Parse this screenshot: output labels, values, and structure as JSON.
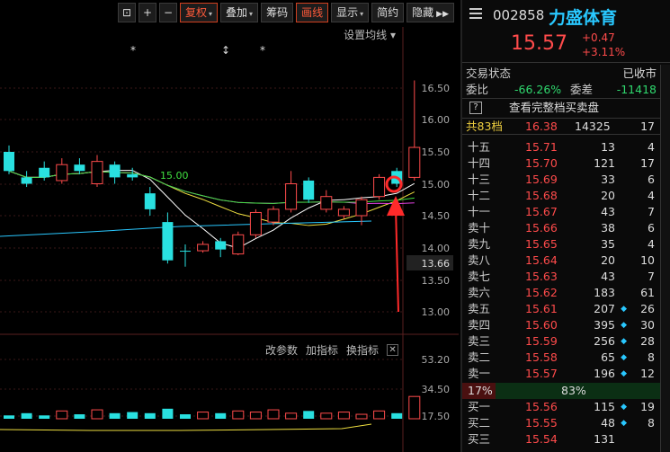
{
  "toolbar": {
    "items": [
      "复权",
      "叠加",
      "筹码",
      "画线",
      "显示",
      "简约",
      "隐藏"
    ],
    "expand_icon": "double-chevron-right-icon"
  },
  "chart": {
    "settings_label": "设置均线",
    "price_ticks": [
      "16.50",
      "16.00",
      "15.50",
      "15.00",
      "14.50",
      "14.00",
      "13.66",
      "13.50",
      "13.00"
    ],
    "ma_label": "15.00",
    "markers": [
      "*",
      "↕",
      "*"
    ],
    "vol_ticks": [
      "53.20",
      "34.50",
      "17.50"
    ],
    "bottom_tools": [
      "改参数",
      "加指标",
      "换指标"
    ],
    "candles": [
      {
        "o": 15.5,
        "c": 15.2,
        "h": 15.6,
        "l": 15.15
      },
      {
        "o": 15.1,
        "c": 15.0,
        "h": 15.2,
        "l": 14.95
      },
      {
        "o": 15.25,
        "c": 15.1,
        "h": 15.35,
        "l": 15.05
      },
      {
        "o": 15.05,
        "c": 15.3,
        "h": 15.4,
        "l": 15.0
      },
      {
        "o": 15.3,
        "c": 15.2,
        "h": 15.4,
        "l": 15.15
      },
      {
        "o": 15.0,
        "c": 15.35,
        "h": 15.45,
        "l": 14.95
      },
      {
        "o": 15.3,
        "c": 15.1,
        "h": 15.35,
        "l": 15.0
      },
      {
        "o": 15.15,
        "c": 15.1,
        "h": 15.25,
        "l": 15.05
      },
      {
        "o": 14.85,
        "c": 14.6,
        "h": 14.95,
        "l": 14.5
      },
      {
        "o": 14.4,
        "c": 13.8,
        "h": 14.55,
        "l": 13.75
      },
      {
        "o": 13.95,
        "c": 13.94,
        "h": 14.05,
        "l": 13.7
      },
      {
        "o": 13.95,
        "c": 14.05,
        "h": 14.1,
        "l": 13.92
      },
      {
        "o": 14.1,
        "c": 13.97,
        "h": 14.15,
        "l": 13.85
      },
      {
        "o": 13.9,
        "c": 14.2,
        "h": 14.25,
        "l": 13.88
      },
      {
        "o": 14.2,
        "c": 14.55,
        "h": 14.6,
        "l": 14.15
      },
      {
        "o": 14.4,
        "c": 14.6,
        "h": 14.65,
        "l": 14.35
      },
      {
        "o": 14.6,
        "c": 15.0,
        "h": 15.2,
        "l": 14.55
      },
      {
        "o": 15.05,
        "c": 14.75,
        "h": 15.1,
        "l": 14.7
      },
      {
        "o": 14.6,
        "c": 14.8,
        "h": 14.9,
        "l": 14.55
      },
      {
        "o": 14.5,
        "c": 14.6,
        "h": 14.65,
        "l": 14.45
      },
      {
        "o": 14.5,
        "c": 14.75,
        "h": 14.8,
        "l": 14.35
      },
      {
        "o": 14.8,
        "c": 15.1,
        "h": 15.15,
        "l": 14.75
      },
      {
        "o": 15.2,
        "c": 15.0,
        "h": 15.25,
        "l": 14.95
      },
      {
        "o": 15.1,
        "c": 15.57,
        "h": 16.62,
        "l": 15.05
      }
    ],
    "volumes": [
      3,
      5,
      3,
      7,
      4,
      8,
      5,
      6,
      5,
      9,
      4,
      6,
      5,
      7,
      6,
      8,
      5,
      7,
      5,
      6,
      4,
      7,
      5,
      20
    ],
    "annotation_color": "#ff2a2a"
  },
  "quote": {
    "code": "002858",
    "name": "力盛体育",
    "price": "15.57",
    "change": "+0.47",
    "change_pct": "+3.11%"
  },
  "status": {
    "label": "交易状态",
    "value": "已收市"
  },
  "ratio": {
    "label1": "委比",
    "value1": "-66.26%",
    "label2": "委差",
    "value2": "-11418"
  },
  "full_book": {
    "icon": "?",
    "label": "查看完整档买卖盘"
  },
  "total": {
    "label": "共83档",
    "price": "16.38",
    "vol": "14325",
    "count": "17"
  },
  "asks": [
    {
      "label": "十五",
      "price": "15.71",
      "vol": "13",
      "count": "4",
      "dot": false
    },
    {
      "label": "十四",
      "price": "15.70",
      "vol": "121",
      "count": "17",
      "dot": false
    },
    {
      "label": "十三",
      "price": "15.69",
      "vol": "33",
      "count": "6",
      "dot": false
    },
    {
      "label": "十二",
      "price": "15.68",
      "vol": "20",
      "count": "4",
      "dot": false
    },
    {
      "label": "十一",
      "price": "15.67",
      "vol": "43",
      "count": "7",
      "dot": false
    },
    {
      "label": "卖十",
      "price": "15.66",
      "vol": "38",
      "count": "6",
      "dot": false
    },
    {
      "label": "卖九",
      "price": "15.65",
      "vol": "35",
      "count": "4",
      "dot": false
    },
    {
      "label": "卖八",
      "price": "15.64",
      "vol": "20",
      "count": "10",
      "dot": false
    },
    {
      "label": "卖七",
      "price": "15.63",
      "vol": "43",
      "count": "7",
      "dot": false
    },
    {
      "label": "卖六",
      "price": "15.62",
      "vol": "183",
      "count": "61",
      "dot": false
    },
    {
      "label": "卖五",
      "price": "15.61",
      "vol": "207",
      "count": "26",
      "dot": true
    },
    {
      "label": "卖四",
      "price": "15.60",
      "vol": "395",
      "count": "30",
      "dot": true
    },
    {
      "label": "卖三",
      "price": "15.59",
      "vol": "256",
      "count": "28",
      "dot": true
    },
    {
      "label": "卖二",
      "price": "15.58",
      "vol": "65",
      "count": "8",
      "dot": true
    },
    {
      "label": "卖一",
      "price": "15.57",
      "vol": "196",
      "count": "12",
      "dot": true
    }
  ],
  "balance": {
    "ask_pct": "17%",
    "bid_pct": "83%",
    "bid_fraction": 0.83
  },
  "bids": [
    {
      "label": "买一",
      "price": "15.56",
      "vol": "115",
      "count": "19",
      "dot": true
    },
    {
      "label": "买二",
      "price": "15.55",
      "vol": "48",
      "count": "8",
      "dot": true
    },
    {
      "label": "买三",
      "price": "15.54",
      "vol": "131",
      "count": "",
      "dot": false
    }
  ]
}
